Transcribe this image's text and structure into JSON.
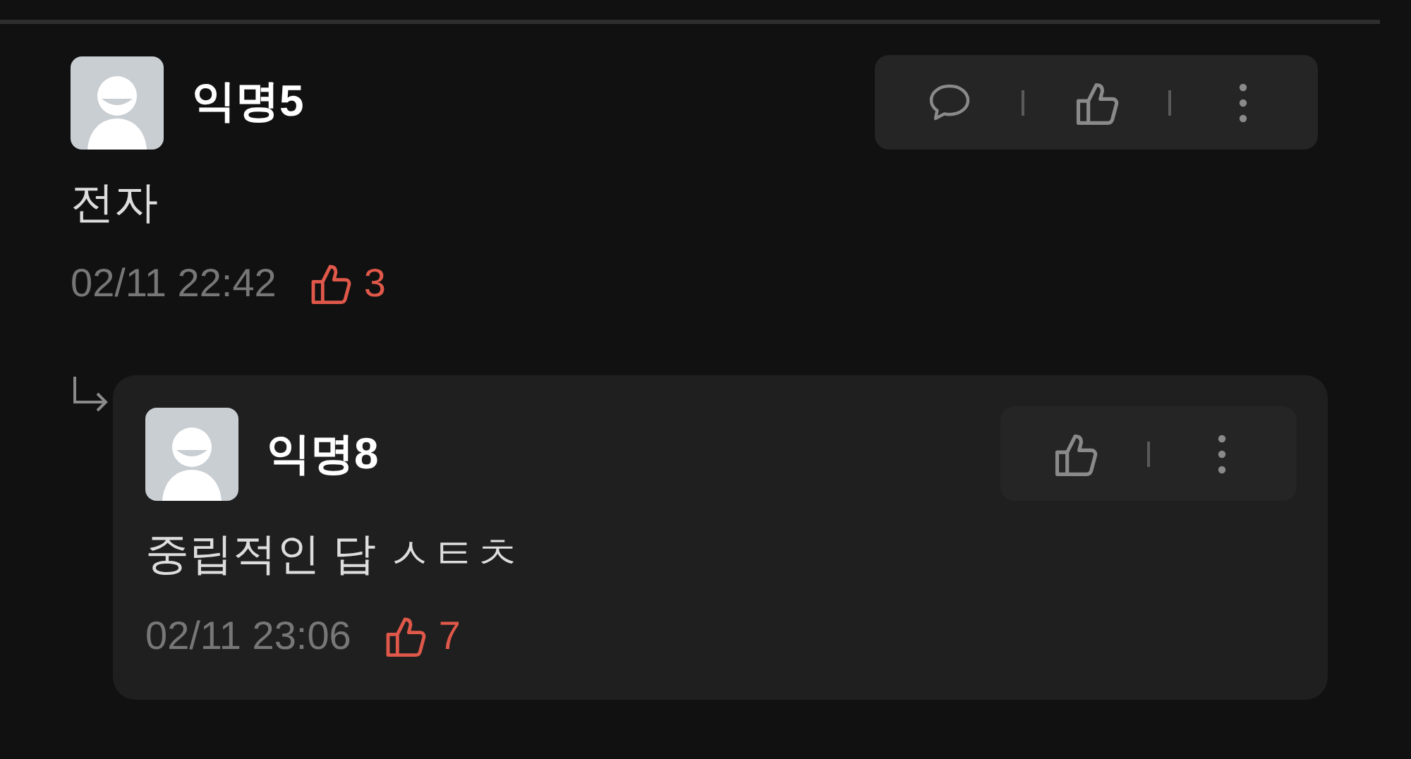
{
  "comments": [
    {
      "author": "익명5",
      "text": "전자",
      "time": "02/11 22:42",
      "likes": "3",
      "actions": [
        {
          "kind": "comment"
        },
        {
          "kind": "like"
        },
        {
          "kind": "more"
        }
      ],
      "replies": [
        {
          "author": "익명8",
          "text": "중립적인 답 ㅅㅌㅊ",
          "time": "02/11 23:06",
          "likes": "7",
          "actions": [
            {
              "kind": "like"
            },
            {
              "kind": "more"
            }
          ]
        }
      ]
    }
  ]
}
